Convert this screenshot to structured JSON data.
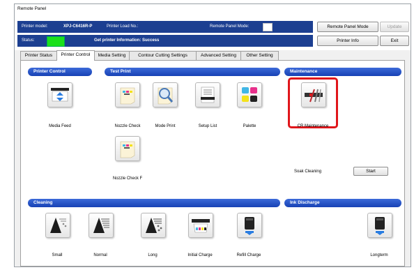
{
  "window": {
    "title": "Remote Panel"
  },
  "info": {
    "model_label": "Printer model:",
    "model_value": "XPJ-C6416R-P",
    "load_label": "Printer Load No.:",
    "panel_mode_label": "Remote Panel Mode:",
    "status_label": "Status:",
    "status_message": "Get printer Information: Success",
    "status_color": "#1be01b"
  },
  "buttons": {
    "remote_panel_mode": "Remote Panel Mode",
    "update": "Update",
    "printer_info": "Printer Info",
    "exit": "Exit",
    "start": "Start"
  },
  "tabs": [
    "Printer Status",
    "Printer Control",
    "Media Setting",
    "Contour Cutting Settings",
    "Advanced Setting",
    "Other Setting"
  ],
  "active_tab": "Printer Control",
  "sections": {
    "printer_control": "Printer Control",
    "test_print": "Test Print",
    "maintenance": "Maintenance",
    "cleaning": "Cleaning",
    "ink_discharge": "Ink Discharge"
  },
  "items": {
    "media_feed": "Media Feed",
    "nozzle_check": "Nozzle Check",
    "mode_print": "Mode Print",
    "setup_list": "Setup List",
    "palette": "Palette",
    "nozzle_check_f": "Nozzle Check F",
    "cr_maintenance": "CR Maintenance",
    "soak_cleaning": "Soak Cleaning",
    "small": "Small",
    "normal": "Normal",
    "long": "Long",
    "initial_charge": "Initial Charge",
    "refill_charge": "Refill Charge",
    "longterm": "Longterm"
  },
  "colors": {
    "accent": "#1c3f91",
    "highlight": "#e0161b"
  }
}
